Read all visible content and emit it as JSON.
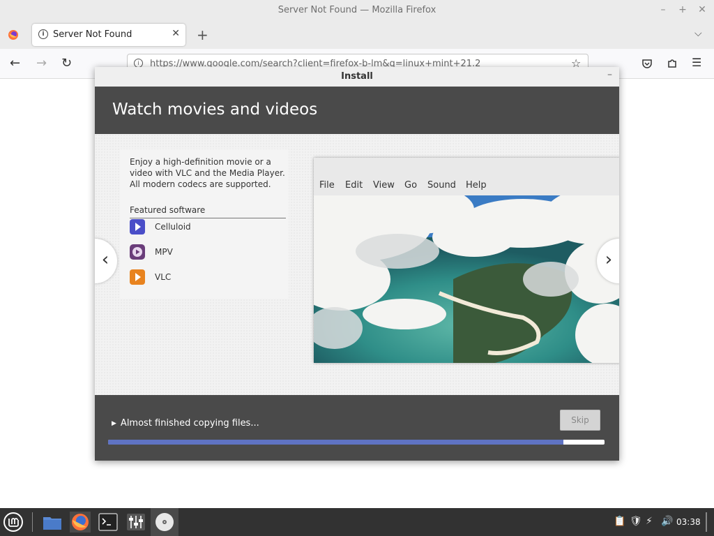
{
  "window": {
    "title": "Server Not Found — Mozilla Firefox"
  },
  "browser": {
    "tab_title": "Server Not Found",
    "url": "https://www.google.com/search?client=firefox-b-lm&q=linux+mint+21.2"
  },
  "dialog": {
    "title": "Install",
    "header": "Watch movies and videos",
    "description": "Enjoy a high-definition movie or a video with VLC and the Media Player. All modern codecs are supported.",
    "featured_label": "Featured software",
    "apps": [
      {
        "name": "Celluloid",
        "icon": "celluloid-icon",
        "color": "#4a4ec8"
      },
      {
        "name": "MPV",
        "icon": "mpv-icon",
        "color": "#6a3d7a"
      },
      {
        "name": "VLC",
        "icon": "vlc-icon",
        "color": "#e8831f"
      }
    ],
    "preview_menu": [
      "File",
      "Edit",
      "View",
      "Go",
      "Sound",
      "Help"
    ],
    "status": "Almost finished copying files...",
    "skip_label": "Skip",
    "progress": 0.917
  },
  "taskbar": {
    "clock": "03:38"
  },
  "colors": {
    "header_bg": "#4a4a4a",
    "progress_fill": "#5f73c3",
    "taskbar_bg": "#323232"
  }
}
